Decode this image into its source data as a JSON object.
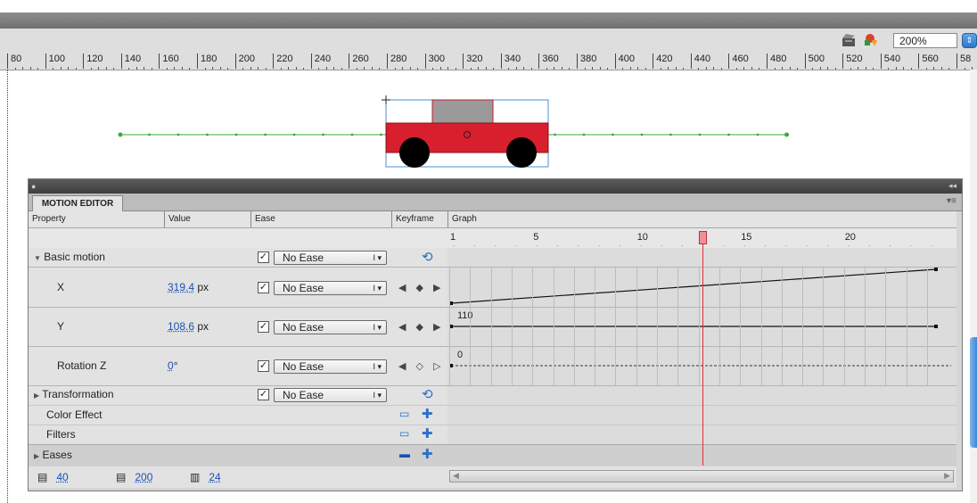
{
  "toolbar": {
    "zoom_value": "200%",
    "icons": [
      "edit-scene-icon",
      "edit-symbol-icon"
    ]
  },
  "ruler": {
    "labels": [
      "80",
      "100",
      "120",
      "140",
      "160",
      "180",
      "200",
      "220",
      "240",
      "260",
      "280",
      "300",
      "320",
      "340",
      "360",
      "380",
      "400",
      "420",
      "440",
      "460",
      "480",
      "500",
      "520",
      "540",
      "560",
      "58"
    ]
  },
  "motion_editor": {
    "tab_label": "MOTION EDITOR",
    "headers": {
      "property": "Property",
      "value": "Value",
      "ease": "Ease",
      "keyframe": "Keyframe",
      "graph": "Graph"
    },
    "frame_numbers": [
      "1",
      "5",
      "10",
      "15",
      "20"
    ],
    "playhead_frame": 13,
    "rows": [
      {
        "label": "Basic motion",
        "expanded": true,
        "ease": "No Ease"
      },
      {
        "label": "X",
        "value": "319.4",
        "unit": "px",
        "ease": "No Ease",
        "graph_label": ""
      },
      {
        "label": "Y",
        "value": "108.6",
        "unit": "px",
        "ease": "No Ease",
        "graph_label": "110"
      },
      {
        "label": "Rotation Z",
        "value": "0",
        "unit": "°",
        "ease": "No Ease",
        "graph_label": "0"
      },
      {
        "label": "Transformation",
        "expanded": false,
        "ease": "No Ease"
      },
      {
        "label": "Color Effect"
      },
      {
        "label": "Filters"
      },
      {
        "label": "Eases",
        "expanded": false
      }
    ],
    "footer": {
      "graph_size": "40",
      "expanded_graph_size": "200",
      "viewable_frames": "24"
    }
  },
  "colors": {
    "car_body": "#d71f2d",
    "car_roof": "#9a9a9a",
    "motion_path": "#3bab3b",
    "playhead": "#d9303a",
    "link": "#1a4fb8"
  }
}
